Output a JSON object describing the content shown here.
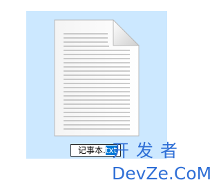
{
  "file_item": {
    "name_text": "记事本.",
    "extension_selected": "txt",
    "icon": "text-document-icon",
    "selection_color": "#cce8ff"
  },
  "watermark": {
    "chinese": "开发者",
    "english": "DevZe.CoM",
    "color": "#2f6fd6"
  }
}
